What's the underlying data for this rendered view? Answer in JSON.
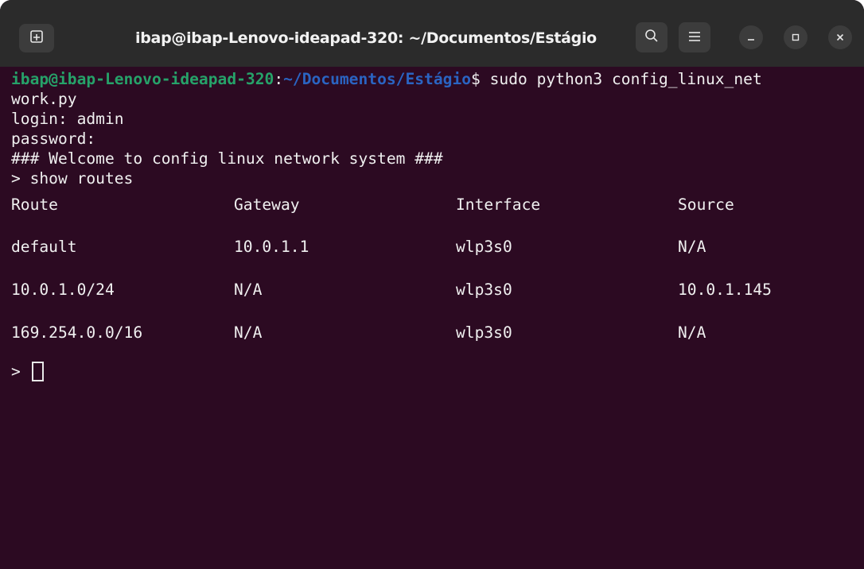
{
  "window": {
    "title": "ibap@ibap-Lenovo-ideapad-320: ~/Documentos/Estágio",
    "icons": [
      "new-tab-icon",
      "search-icon",
      "hamburger-menu-icon",
      "minimize-icon",
      "maximize-icon",
      "close-icon"
    ],
    "colors": {
      "background": "#2c0a22",
      "titlebar": "#2b2b2b",
      "prompt_user": "#26a269",
      "prompt_path": "#2a64c2",
      "text": "#f0f0f0"
    }
  },
  "terminal": {
    "prompt_user": "ibap@ibap-Lenovo-ideapad-320",
    "prompt_sep": ":",
    "prompt_path": "~/Documentos/Estágio",
    "prompt_dollar": "$",
    "command_part1": " sudo python3 config_linux_net",
    "command_part2": "work.py",
    "login_line": "login: admin",
    "password_line": "password:",
    "welcome_line": "### Welcome to config linux network system ###",
    "show_routes_line": "> show routes",
    "table": {
      "headers": [
        "Route",
        "Gateway",
        "Interface",
        "Source"
      ],
      "rows": [
        [
          "default",
          "10.0.1.1",
          "wlp3s0",
          "N/A"
        ],
        [
          "10.0.1.0/24",
          "N/A",
          "wlp3s0",
          "10.0.1.145"
        ],
        [
          "169.254.0.0/16",
          "N/A",
          "wlp3s0",
          "N/A"
        ]
      ]
    },
    "input_prompt": ">"
  }
}
